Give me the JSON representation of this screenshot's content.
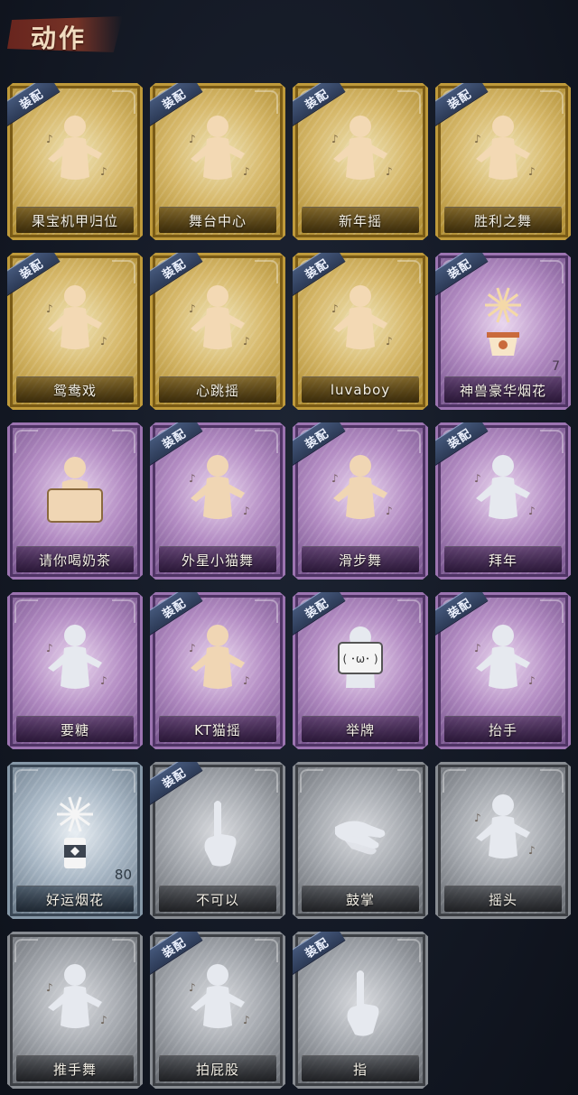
{
  "header": {
    "title": "动作"
  },
  "badge_text": "装配",
  "cards": [
    {
      "label": "果宝机甲归位",
      "rarity": "gold",
      "equipped": true,
      "icon": "figure-arms-crossed-icon"
    },
    {
      "label": "舞台中心",
      "rarity": "gold",
      "equipped": true,
      "icon": "figure-pose-sparkle-icon"
    },
    {
      "label": "新年摇",
      "rarity": "gold",
      "equipped": true,
      "icon": "figure-clap-icon"
    },
    {
      "label": "胜利之舞",
      "rarity": "gold",
      "equipped": true,
      "icon": "figure-point-up-icon"
    },
    {
      "label": "鸳鸯戏",
      "rarity": "gold",
      "equipped": true,
      "icon": "figure-dance-icon"
    },
    {
      "label": "心跳摇",
      "rarity": "gold",
      "equipped": true,
      "icon": "figure-hand-up-icon"
    },
    {
      "label": "luvaboy",
      "rarity": "gold",
      "equipped": true,
      "icon": "figure-arms-crossed-icon"
    },
    {
      "label": "神兽豪华烟花",
      "rarity": "purple",
      "equipped": true,
      "icon": "fireworks-pot-icon",
      "count": "7"
    },
    {
      "label": "请你喝奶茶",
      "rarity": "purple",
      "equipped": false,
      "icon": "figure-sign-icon"
    },
    {
      "label": "外星小猫舞",
      "rarity": "purple",
      "equipped": true,
      "icon": "figure-point-side-icon"
    },
    {
      "label": "滑步舞",
      "rarity": "purple",
      "equipped": true,
      "icon": "figure-dance-icon"
    },
    {
      "label": "拜年",
      "rarity": "purple",
      "equipped": true,
      "icon": "figure-bow-icon"
    },
    {
      "label": "要糖",
      "rarity": "purple",
      "equipped": false,
      "icon": "figure-reach-icon"
    },
    {
      "label": "KT猫摇",
      "rarity": "purple",
      "equipped": true,
      "icon": "figure-sway-icon"
    },
    {
      "label": "举牌",
      "rarity": "purple",
      "equipped": true,
      "icon": "figure-sign-cat-icon"
    },
    {
      "label": "抬手",
      "rarity": "purple",
      "equipped": true,
      "icon": "figure-raise-hand-icon"
    },
    {
      "label": "好运烟花",
      "rarity": "blue",
      "equipped": false,
      "icon": "fireworks-can-icon",
      "count": "80"
    },
    {
      "label": "不可以",
      "rarity": "gray",
      "equipped": true,
      "icon": "finger-wag-icon"
    },
    {
      "label": "鼓掌",
      "rarity": "gray",
      "equipped": false,
      "icon": "clapping-hands-icon"
    },
    {
      "label": "摇头",
      "rarity": "gray",
      "equipped": false,
      "icon": "figure-shake-head-icon"
    },
    {
      "label": "推手舞",
      "rarity": "gray",
      "equipped": false,
      "icon": "figure-push-icon"
    },
    {
      "label": "拍屁股",
      "rarity": "gray",
      "equipped": true,
      "icon": "figure-bend-icon"
    },
    {
      "label": "指",
      "rarity": "gray",
      "equipped": true,
      "icon": "pointing-hand-icon"
    }
  ],
  "colors": {
    "gold_figure": "#f3d9b4",
    "purple_figure": "#f0d6b4",
    "pale_figure": "#e6e9ef",
    "badge": "#33415f"
  }
}
